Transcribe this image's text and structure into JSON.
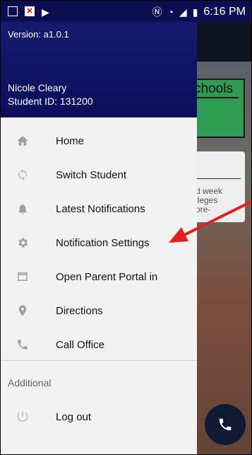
{
  "status_bar": {
    "time": "6:16 PM"
  },
  "drawer": {
    "version": "Version: a1.0.1",
    "user_name": "Nicole Cleary",
    "student_id": "Student ID: 131200",
    "menu_items": [
      {
        "label": "Home",
        "icon": "home-icon"
      },
      {
        "label": "Switch Student",
        "icon": "swap-icon"
      },
      {
        "label": "Latest Notifications",
        "icon": "bell-icon"
      },
      {
        "label": "Notification Settings",
        "icon": "gear-icon"
      },
      {
        "label": "Open Parent Portal in",
        "icon": "browser-window-icon"
      },
      {
        "label": "Directions",
        "icon": "map-pin-icon"
      },
      {
        "label": "Call Office",
        "icon": "phone-icon"
      }
    ],
    "section_label": "Additional",
    "logout_label": "Log out"
  },
  "background_app": {
    "card_title": "chools",
    "card_text": [
      "d week",
      "lleges",
      "ore-"
    ]
  },
  "colors": {
    "drawer_header": "#0f1363",
    "annotation_arrow": "#e02020"
  }
}
